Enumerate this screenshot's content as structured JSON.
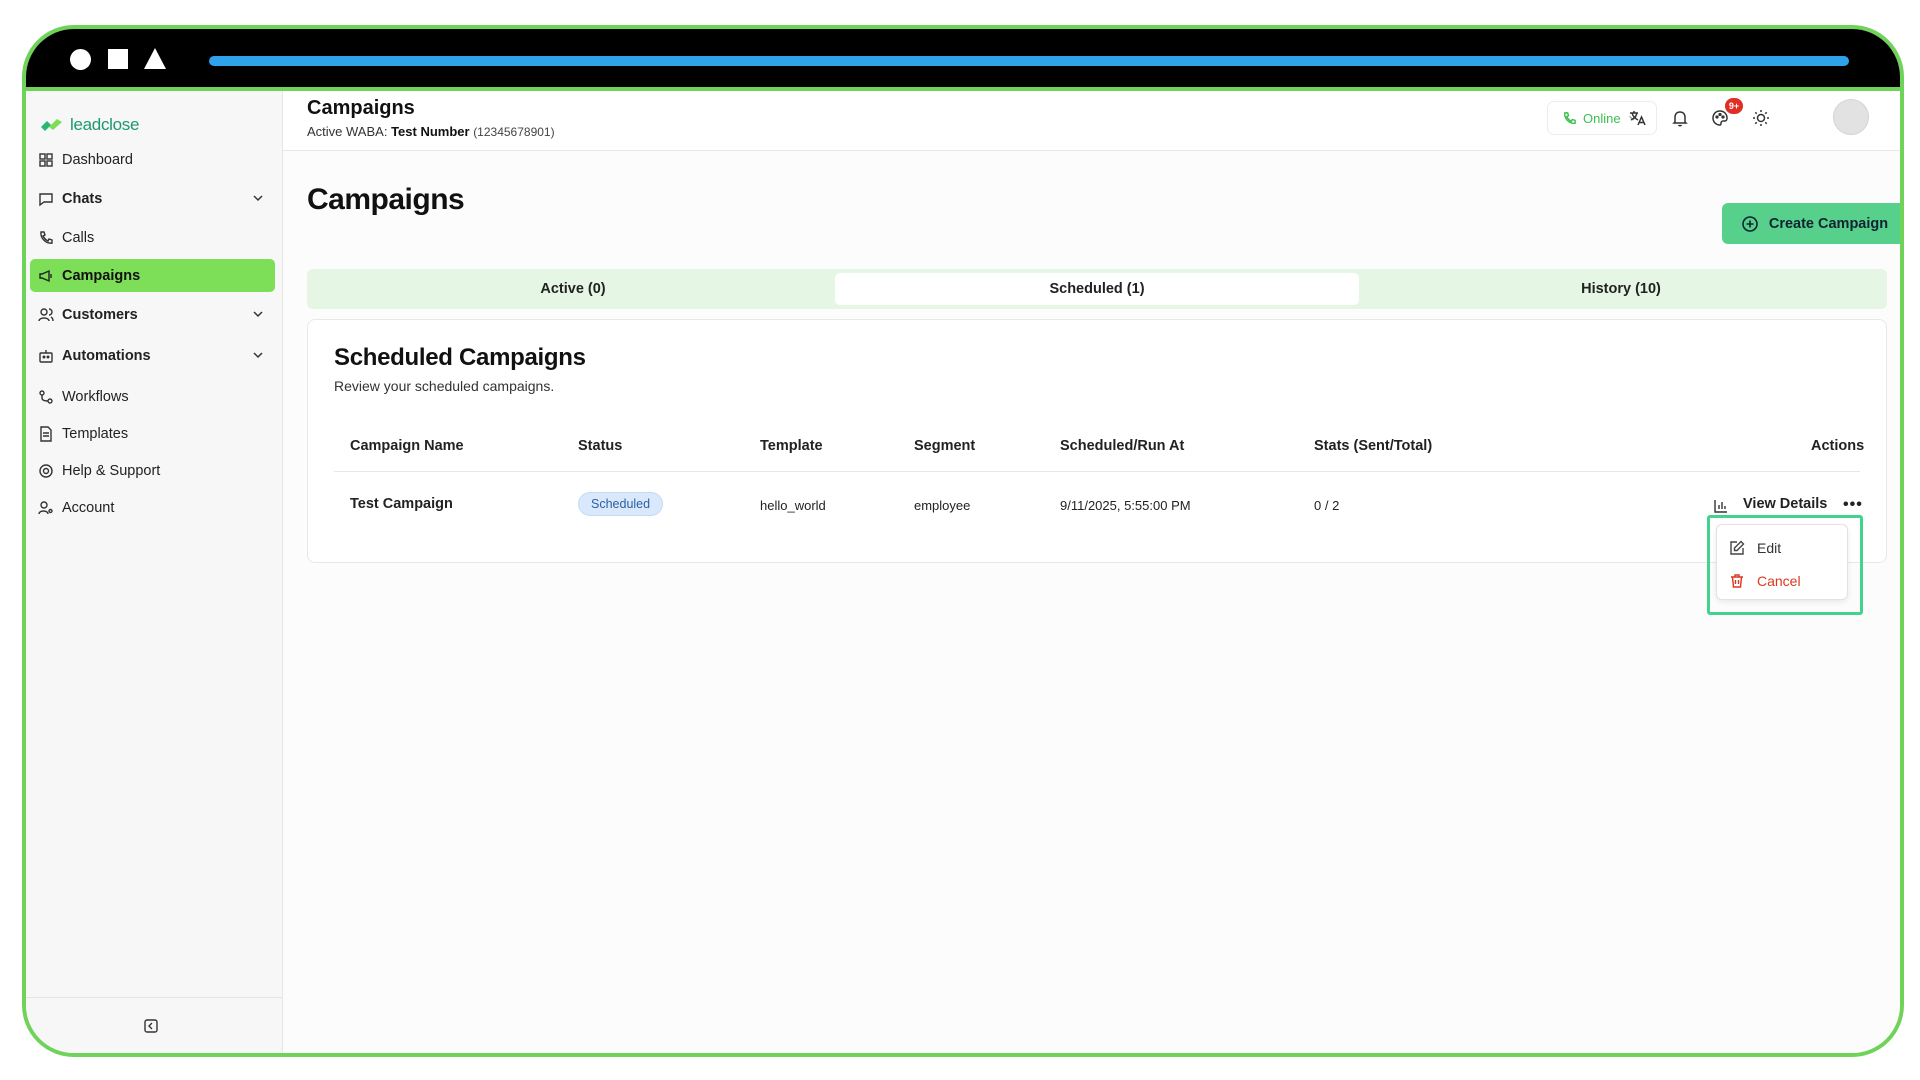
{
  "app": {
    "brand": "leadclose"
  },
  "sidebar": {
    "items": [
      {
        "label": "Dashboard",
        "icon": "dashboard-icon"
      },
      {
        "label": "Chats",
        "icon": "chat-icon",
        "expandable": true
      },
      {
        "label": "Calls",
        "icon": "phone-icon"
      },
      {
        "label": "Campaigns",
        "icon": "megaphone-icon",
        "active": true
      },
      {
        "label": "Customers",
        "icon": "users-icon",
        "expandable": true
      },
      {
        "label": "Automations",
        "icon": "bot-icon",
        "expandable": true
      },
      {
        "label": "Workflows",
        "icon": "workflow-icon"
      },
      {
        "label": "Templates",
        "icon": "template-icon"
      },
      {
        "label": "Help & Support",
        "icon": "help-icon"
      },
      {
        "label": "Account",
        "icon": "account-icon"
      }
    ]
  },
  "header": {
    "title": "Campaigns",
    "waba_prefix": "Active WABA:",
    "waba_name": "Test Number",
    "waba_number": "(12345678901)",
    "status_label": "Online",
    "notification_badge": "9+"
  },
  "page": {
    "title": "Campaigns",
    "create_label": "Create Campaign",
    "tabs": [
      {
        "label": "Active (0)"
      },
      {
        "label": "Scheduled (1)",
        "selected": true
      },
      {
        "label": "History (10)"
      }
    ]
  },
  "card": {
    "title": "Scheduled Campaigns",
    "subtitle": "Review your scheduled campaigns.",
    "columns": [
      "Campaign Name",
      "Status",
      "Template",
      "Segment",
      "Scheduled/Run At",
      "Stats (Sent/Total)",
      "Actions"
    ],
    "rows": [
      {
        "name": "Test Campaign",
        "status": "Scheduled",
        "template": "hello_world",
        "segment": "employee",
        "run_at": "9/11/2025, 5:55:00 PM",
        "stats": "0 / 2",
        "view_label": "View Details",
        "more_label": "•••"
      }
    ]
  },
  "menu": {
    "edit_label": "Edit",
    "cancel_label": "Cancel"
  },
  "colors": {
    "accent": "#7dde58",
    "primary_button": "#56d08a",
    "danger": "#d9381e",
    "frame": "#6fd35a"
  }
}
